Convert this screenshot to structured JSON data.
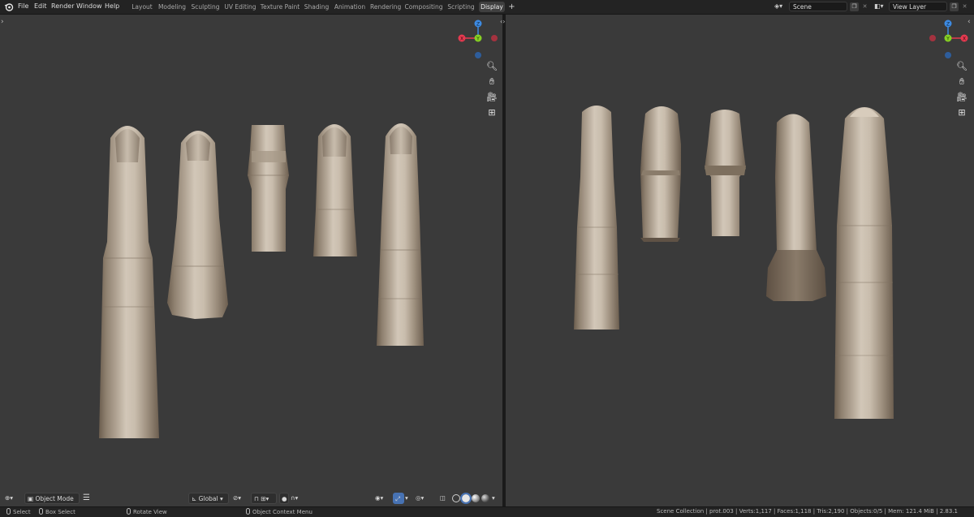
{
  "menus": [
    "File",
    "Edit",
    "Render",
    "Window",
    "Help"
  ],
  "workspaces": {
    "tabs": [
      "Layout",
      "Modeling",
      "Sculpting",
      "UV Editing",
      "Texture Paint",
      "Shading",
      "Animation",
      "Rendering",
      "Compositing",
      "Scripting",
      "Display"
    ],
    "active": "Display",
    "add_label": "+"
  },
  "scene": {
    "name": "Scene"
  },
  "view_layer": {
    "name": "View Layer"
  },
  "viewport_left": {
    "mode": "Object Mode",
    "transform_orientation": "Global",
    "gizmo_axes": [
      "Z",
      "Y",
      "X"
    ],
    "icons": [
      "zoom-icon",
      "hand-icon",
      "camera-icon",
      "grid-icon"
    ]
  },
  "viewport_right": {
    "gizmo_axes": [
      "Z",
      "Y",
      "X"
    ],
    "icons": [
      "zoom-icon",
      "hand-icon",
      "camera-icon",
      "grid-icon"
    ]
  },
  "colors": {
    "x_axis": "#e63a50",
    "y_axis": "#86d024",
    "z_axis": "#3d8be3",
    "viewport_bg": "#3a3a3a",
    "finger_light": "#cbbfae",
    "finger_dark": "#6c5e4f"
  },
  "statusbar": {
    "select": "Select",
    "box_select": "Box Select",
    "rotate_view": "Rotate View",
    "context_menu": "Object Context Menu",
    "stats": "Scene Collection | prot.003 | Verts:1,117 | Faces:1,118 | Tris:2,190 | Objects:0/5 | Mem: 121.4 MiB | 2.83.1"
  }
}
